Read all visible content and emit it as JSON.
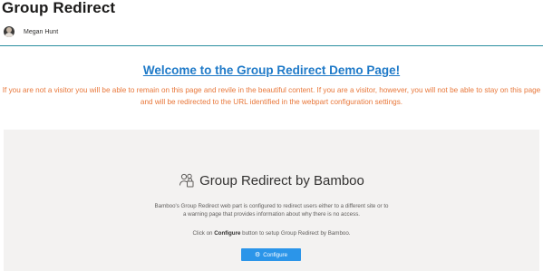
{
  "page": {
    "title": "Group Redirect",
    "author": "Megan Hunt"
  },
  "content": {
    "welcome_heading": "Welcome to the Group Redirect Demo Page!",
    "notice": "If you are not a visitor you will be able to remain on this page and revile in the beautiful content. If you are a visitor, however, you will not be able to stay on this page and will be redirected to the URL identified in the webpart configuration settings."
  },
  "webpart": {
    "icon": "people-settings-icon",
    "title": "Group Redirect by Bamboo",
    "description": "Bamboo's Group Redirect web part is configured to redirect users either to a different site or to a warning page that provides information about why there is no access.",
    "hint_prefix": "Click on ",
    "hint_bold": "Configure",
    "hint_suffix": " button to setup Group Redirect by Bamboo.",
    "button_icon": "gear-icon",
    "button_label": "Configure"
  },
  "colors": {
    "accent": "#2b95e9",
    "link": "#1f7ac8",
    "notice": "#e8773a",
    "divider": "#2a8fa0",
    "panel": "#f3f2f1"
  }
}
